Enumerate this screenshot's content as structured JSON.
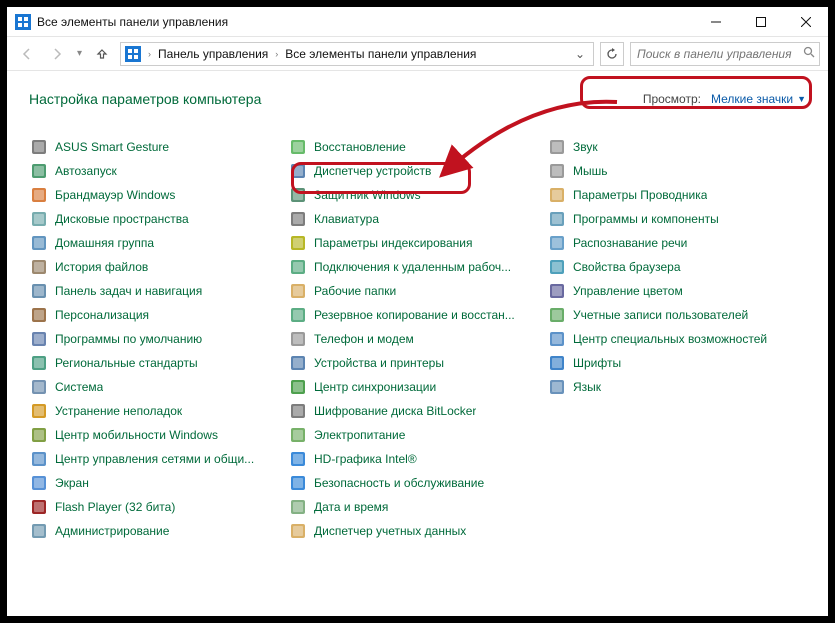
{
  "window": {
    "title": "Все элементы панели управления"
  },
  "nav": {
    "crumb1": "Панель управления",
    "crumb2": "Все элементы панели управления"
  },
  "search": {
    "placeholder": "Поиск в панели управления"
  },
  "header": {
    "title": "Настройка параметров компьютера",
    "view_label": "Просмотр:",
    "view_value": "Мелкие значки"
  },
  "items": {
    "col1": [
      "ASUS Smart Gesture",
      "Автозапуск",
      "Брандмауэр Windows",
      "Дисковые пространства",
      "Домашняя группа",
      "История файлов",
      "Панель задач и навигация",
      "Персонализация",
      "Программы по умолчанию",
      "Региональные стандарты",
      "Система",
      "Устранение неполадок",
      "Центр мобильности Windows",
      "Центр управления сетями и общи...",
      "Экран"
    ],
    "col2": [
      "Flash Player (32 бита)",
      "Администрирование",
      "Восстановление",
      "Диспетчер устройств",
      "Защитник Windows",
      "Клавиатура",
      "Параметры индексирования",
      "Подключения к удаленным рабоч...",
      "Рабочие папки",
      "Резервное копирование и восстан...",
      "Телефон и модем",
      "Устройства и принтеры",
      "Центр синхронизации",
      "Шифрование диска BitLocker",
      "Электропитание"
    ],
    "col3": [
      "HD-графика Intel®",
      "Безопасность и обслуживание",
      "Дата и время",
      "Диспетчер учетных данных",
      "Звук",
      "Мышь",
      "Параметры Проводника",
      "Программы и компоненты",
      "Распознавание речи",
      "Свойства браузера",
      "Управление цветом",
      "Учетные записи пользователей",
      "Центр специальных возможностей",
      "Шрифты",
      "Язык"
    ]
  },
  "iconColors": {
    "col1": [
      "#666666",
      "#2e8b57",
      "#d2691e",
      "#5f9ea0",
      "#4682b4",
      "#8b7355",
      "#4f7da1",
      "#8b5a2b",
      "#4f6da1",
      "#2f8f6f",
      "#5c7fa3",
      "#cc8800",
      "#6b8e23",
      "#3f7fbf",
      "#3a7ecf"
    ],
    "col2": [
      "#8b0000",
      "#5b8aa5",
      "#4caf50",
      "#3f6fa3",
      "#3f7f5f",
      "#666666",
      "#aaaa00",
      "#3f9f6f",
      "#d2a24c",
      "#3f9f6f",
      "#888888",
      "#3f6fa3",
      "#2f8f2f",
      "#666666",
      "#5fa34f"
    ],
    "col3": [
      "#1976d2",
      "#1976d2",
      "#6fa36f",
      "#d2a24c",
      "#888888",
      "#888888",
      "#d2a24c",
      "#4f8faf",
      "#4f8fbf",
      "#2f8faf",
      "#4f4f8f",
      "#4f9f4f",
      "#3f7fbf",
      "#1f6fbf",
      "#4f7faf"
    ]
  }
}
